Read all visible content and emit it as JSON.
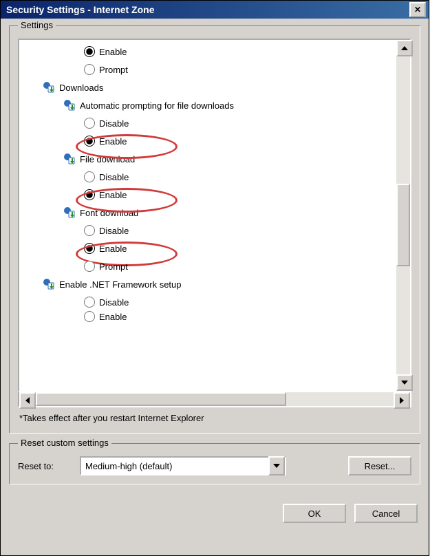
{
  "window": {
    "title": "Security Settings - Internet Zone",
    "close_glyph": "✕"
  },
  "settings": {
    "legend": "Settings",
    "rows": [
      {
        "type": "radio",
        "indent": 3,
        "label": "Enable",
        "checked": true,
        "highlight": false,
        "group": "g0"
      },
      {
        "type": "radio",
        "indent": 3,
        "label": "Prompt",
        "checked": false,
        "highlight": false,
        "group": "g0"
      },
      {
        "type": "header",
        "indent": 1,
        "label": "Downloads"
      },
      {
        "type": "header",
        "indent": 2,
        "label": "Automatic prompting for file downloads"
      },
      {
        "type": "radio",
        "indent": 3,
        "label": "Disable",
        "checked": false,
        "highlight": false,
        "group": "g1"
      },
      {
        "type": "radio",
        "indent": 3,
        "label": "Enable",
        "checked": true,
        "highlight": true,
        "group": "g1"
      },
      {
        "type": "header",
        "indent": 2,
        "label": "File download"
      },
      {
        "type": "radio",
        "indent": 3,
        "label": "Disable",
        "checked": false,
        "highlight": false,
        "group": "g2"
      },
      {
        "type": "radio",
        "indent": 3,
        "label": "Enable",
        "checked": true,
        "highlight": true,
        "group": "g2"
      },
      {
        "type": "header",
        "indent": 2,
        "label": "Font download"
      },
      {
        "type": "radio",
        "indent": 3,
        "label": "Disable",
        "checked": false,
        "highlight": false,
        "group": "g3"
      },
      {
        "type": "radio",
        "indent": 3,
        "label": "Enable",
        "checked": true,
        "highlight": true,
        "group": "g3"
      },
      {
        "type": "radio",
        "indent": 3,
        "label": "Prompt",
        "checked": false,
        "highlight": false,
        "group": "g3"
      },
      {
        "type": "header",
        "indent": 1,
        "label": "Enable .NET Framework setup"
      },
      {
        "type": "radio",
        "indent": 3,
        "label": "Disable",
        "checked": false,
        "highlight": false,
        "group": "g4"
      },
      {
        "type": "radio-cut",
        "indent": 3,
        "label": "Enable",
        "checked": false,
        "highlight": false,
        "group": "g4"
      }
    ],
    "note": "*Takes effect after you restart Internet Explorer"
  },
  "reset": {
    "legend": "Reset custom settings",
    "reset_to_label": "Reset to:",
    "combo_value": "Medium-high (default)",
    "reset_button": "Reset..."
  },
  "buttons": {
    "ok": "OK",
    "cancel": "Cancel"
  }
}
